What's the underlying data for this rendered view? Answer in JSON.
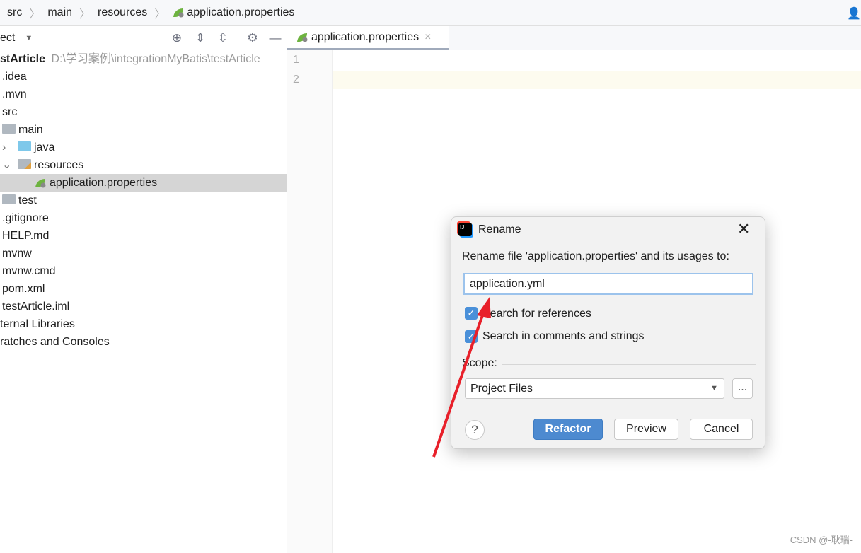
{
  "breadcrumb": [
    "src",
    "main",
    "resources",
    "application.properties"
  ],
  "project_panel": {
    "title": "ect",
    "tools": [
      "locate-icon",
      "expand-all-icon",
      "collapse-all-icon",
      "gear-icon",
      "minimize-icon"
    ]
  },
  "tree": {
    "root_name": "stArticle",
    "root_path": "D:\\学习案例\\integrationMyBatis\\testArticle",
    "items": [
      ".idea",
      ".mvn",
      "src",
      "main",
      "java",
      "resources",
      "application.properties",
      "test",
      ".gitignore",
      "HELP.md",
      "mvnw",
      "mvnw.cmd",
      "pom.xml",
      "testArticle.iml",
      "ternal Libraries",
      "ratches and Consoles"
    ]
  },
  "editor": {
    "tab": "application.properties",
    "lines": [
      "1",
      "2"
    ]
  },
  "dialog": {
    "title": "Rename",
    "prompt": "Rename file 'application.properties' and its usages to:",
    "value": "application.yml",
    "check1": "Search for references",
    "check1_checked": true,
    "check2": "Search in comments and strings",
    "check2_checked": true,
    "scope_label": "Scope:",
    "scope_value": "Project Files",
    "more": "...",
    "help": "?",
    "refactor": "Refactor",
    "preview": "Preview",
    "cancel": "Cancel"
  },
  "colors": {
    "accent": "#4a90d9",
    "arrow": "#e8202a",
    "spring": "#6db33f"
  },
  "watermark": "CSDN @-耿瑞-"
}
